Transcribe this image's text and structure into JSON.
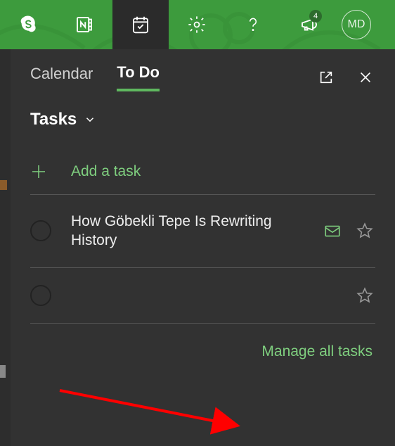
{
  "topbar": {
    "notifications_count": "4",
    "user_initials": "MD"
  },
  "tabs": {
    "calendar": "Calendar",
    "todo": "To Do"
  },
  "tasks": {
    "header": "Tasks",
    "add_label": "Add a task",
    "items": [
      {
        "title": "How Göbekli Tepe Is Rewriting History",
        "has_mail": true
      },
      {
        "title": "",
        "has_mail": false
      }
    ],
    "manage_label": "Manage all tasks"
  },
  "colors": {
    "accent_green": "#7fcf7f",
    "header_green": "#3d9b3d",
    "panel_bg": "#323232"
  }
}
